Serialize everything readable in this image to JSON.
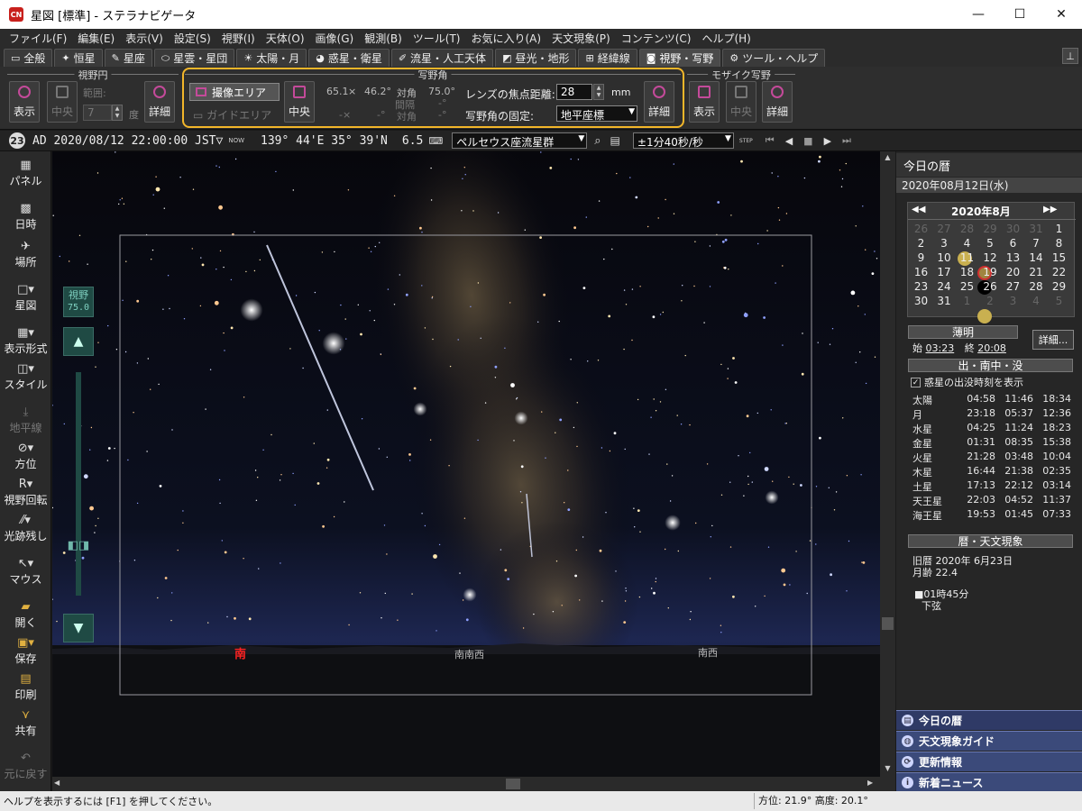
{
  "window": {
    "title": "星図 [標準] - ステラナビゲータ",
    "app_icon": "CN",
    "minimize": "—",
    "maximize": "☐",
    "close": "✕"
  },
  "menu": [
    "ファイル(F)",
    "編集(E)",
    "表示(V)",
    "設定(S)",
    "視野(I)",
    "天体(O)",
    "画像(G)",
    "観測(B)",
    "ツール(T)",
    "お気に入り(A)",
    "天文現象(P)",
    "コンテンツ(C)",
    "ヘルプ(H)"
  ],
  "tabs": [
    {
      "icon": "▭",
      "label": "全般"
    },
    {
      "icon": "✦",
      "label": "恒星"
    },
    {
      "icon": "✎",
      "label": "星座"
    },
    {
      "icon": "⬭",
      "label": "星雲・星団"
    },
    {
      "icon": "☀",
      "label": "太陽・月"
    },
    {
      "icon": "◕",
      "label": "惑星・衛星"
    },
    {
      "icon": "✐",
      "label": "流星・人工天体"
    },
    {
      "icon": "◩",
      "label": "昼光・地形"
    },
    {
      "icon": "⊞",
      "label": "経緯線"
    },
    {
      "icon": "◙",
      "label": "視野・写野",
      "active": true
    },
    {
      "icon": "⚙",
      "label": "ツール・ヘルプ"
    }
  ],
  "pin": "⊥",
  "ribbon": {
    "fov_circle": {
      "title": "視野円",
      "show": "表示",
      "center": "中央",
      "range_label": "範囲:",
      "range_value": "7",
      "unit": "度",
      "detail": "詳細"
    },
    "photo": {
      "title": "写野角",
      "imaging_area": "撮像エリア",
      "guide_area": "ガイドエリア",
      "center": "中央",
      "w": "65.1",
      "x_sign": "×",
      "h": "46.2°",
      "diag_label": "対角",
      "diag": "75.0°",
      "gap_label": "間隔",
      "gap_val": "-°",
      "diag2_label": "対角",
      "diag2_val": "-°",
      "dash_x": "-×",
      "dash_deg": "-°",
      "focal_label": "レンズの焦点距離:",
      "focal_value": "28",
      "focal_unit": "mm",
      "fix_label": "写野角の固定:",
      "fix_value": "地平座標",
      "detail": "詳細"
    },
    "mosaic": {
      "title": "モザイク写野",
      "show": "表示",
      "center": "中央",
      "detail": "詳細"
    }
  },
  "statusline": {
    "badge": "23",
    "datetime": "AD 2020/08/12 22:00:00 JST▽",
    "now": "NOW",
    "coords": "139° 44'E 35° 39'N",
    "mag": "6.5",
    "target": "ペルセウス座流星群",
    "step": "±1分40秒/秒",
    "step_label": "STEP"
  },
  "leftpanel": {
    "panel": "パネル",
    "datetime": "日時",
    "place": "場所",
    "chart": "星図",
    "display": "表示形式",
    "style": "スタイル",
    "horizon": "地平線",
    "direction": "方位",
    "rotate": "視野回転",
    "trail": "光跡残し",
    "mouse": "マウス",
    "open": "開く",
    "save": "保存",
    "print": "印刷",
    "share": "共有",
    "undo": "元に戻す",
    "fov_label": "視野",
    "fov_value": "75.0"
  },
  "sky": {
    "labels": {
      "south": "南",
      "ssw": "南南西",
      "sw": "南西"
    }
  },
  "rightpanel": {
    "header": "今日の暦",
    "date": "2020年08月12日(水)",
    "cal_month": "2020年8月",
    "cal_prev": "◀◀",
    "cal_next": "▶▶",
    "cal_days": [
      [
        "26",
        "27",
        "28",
        "29",
        "30",
        "31",
        "1"
      ],
      [
        "2",
        "3",
        "4",
        "5",
        "6",
        "7",
        "8"
      ],
      [
        "9",
        "10",
        "11",
        "12",
        "13",
        "14",
        "15"
      ],
      [
        "16",
        "17",
        "18",
        "19",
        "20",
        "21",
        "22"
      ],
      [
        "23",
        "24",
        "25",
        "26",
        "27",
        "28",
        "29"
      ],
      [
        "30",
        "31",
        "1",
        "2",
        "3",
        "4",
        "5"
      ]
    ],
    "twilight_title": "薄明",
    "tw_start_label": "始",
    "tw_start": "03:23",
    "tw_end_label": "終",
    "tw_end": "20:08",
    "detail_btn": "詳細...",
    "rise_title": "出・南中・没",
    "rise_checkbox": "惑星の出没時刻を表示",
    "planets": [
      [
        "太陽",
        "04:58",
        "11:46",
        "18:34"
      ],
      [
        "月",
        "23:18",
        "05:37",
        "12:36"
      ],
      [
        "水星",
        "04:25",
        "11:24",
        "18:23"
      ],
      [
        "金星",
        "01:31",
        "08:35",
        "15:38"
      ],
      [
        "火星",
        "21:28",
        "03:48",
        "10:04"
      ],
      [
        "木星",
        "16:44",
        "21:38",
        "02:35"
      ],
      [
        "土星",
        "17:13",
        "22:12",
        "03:14"
      ],
      [
        "天王星",
        "22:03",
        "04:52",
        "11:37"
      ],
      [
        "海王星",
        "19:53",
        "01:45",
        "07:33"
      ]
    ],
    "calendar_title": "暦・天文現象",
    "lunar": "旧暦  2020年  6月23日",
    "moon_age": "月齢  22.4",
    "moon_phase_time": "■01時45分",
    "moon_phase": "下弦",
    "bottom_tabs": [
      "今日の暦",
      "天文現象ガイド",
      "更新情報",
      "新着ニュース"
    ]
  },
  "status": {
    "help": "ヘルプを表示するには [F1] を押してください。",
    "azimuth": "方位:   21.9°  高度:   20.1°"
  },
  "colors": {
    "accent": "#f2b62a",
    "sky": "#06060c",
    "icon": "#c44a9a"
  }
}
